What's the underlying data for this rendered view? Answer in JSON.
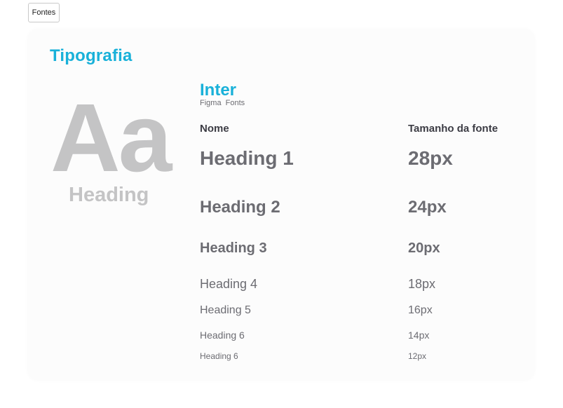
{
  "toolbar": {
    "tab_label": "Fontes"
  },
  "card": {
    "title": "Tipografia",
    "sample": {
      "glyphs": "Aa",
      "label": "Heading"
    },
    "font": {
      "name": "Inter",
      "source": "Figma  Fonts"
    },
    "table": {
      "headers": {
        "name": "Nome",
        "size": "Tamanho da fonte"
      },
      "rows": [
        {
          "name": "Heading 1",
          "size": "28px"
        },
        {
          "name": "Heading 2",
          "size": "24px"
        },
        {
          "name": "Heading 3",
          "size": "20px"
        },
        {
          "name": "Heading 4",
          "size": "18px"
        },
        {
          "name": "Heading 5",
          "size": "16px"
        },
        {
          "name": "Heading 6",
          "size": "14px"
        },
        {
          "name": "Heading 6",
          "size": "12px"
        }
      ]
    }
  },
  "colors": {
    "accent": "#19b1d9",
    "text": "#6c6c72",
    "sample": "#c4c4c5"
  }
}
